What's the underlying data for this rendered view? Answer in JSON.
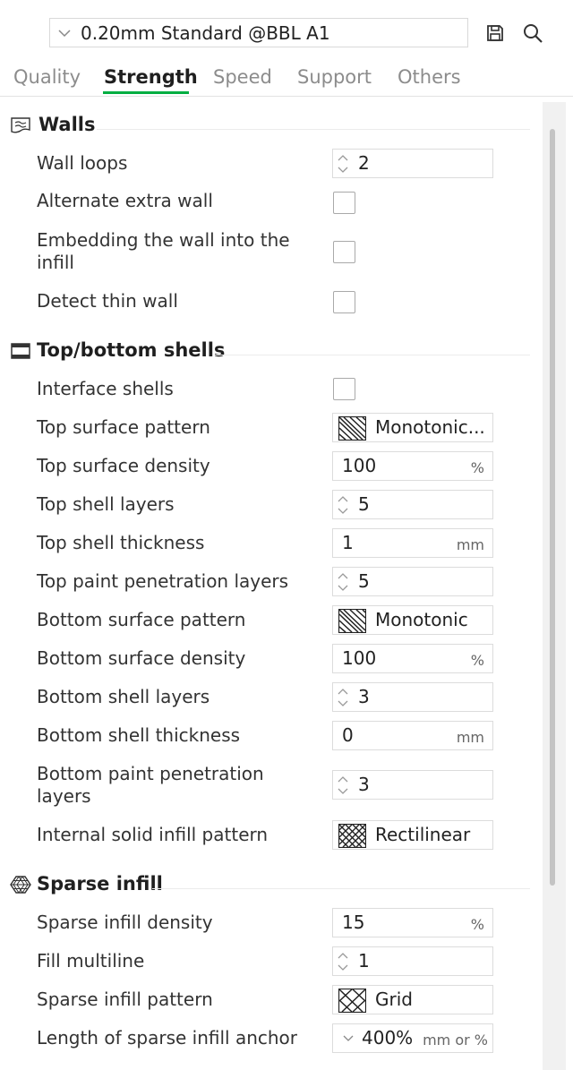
{
  "preset": {
    "value": "0.20mm Standard @BBL A1",
    "save_icon": "save-icon",
    "search_icon": "search-icon"
  },
  "tabs": [
    {
      "label": "Quality",
      "active": false
    },
    {
      "label": "Strength",
      "active": true
    },
    {
      "label": "Speed",
      "active": false
    },
    {
      "label": "Support",
      "active": false
    },
    {
      "label": "Others",
      "active": false
    }
  ],
  "colors": {
    "accent": "#00ae42"
  },
  "walls": {
    "title": "Walls",
    "icon": "walls-icon",
    "wall_loops": {
      "label": "Wall loops",
      "value": "2"
    },
    "alternate_extra_wall": {
      "label": "Alternate extra wall",
      "checked": false
    },
    "embedding_wall": {
      "label": "Embedding the wall into the infill",
      "checked": false
    },
    "detect_thin_wall": {
      "label": "Detect thin wall",
      "checked": false
    }
  },
  "shells": {
    "title": "Top/bottom shells",
    "icon": "shells-icon",
    "interface_shells": {
      "label": "Interface shells",
      "checked": false
    },
    "top_surface_pattern": {
      "label": "Top surface pattern",
      "value": "Monotonic..."
    },
    "top_surface_density": {
      "label": "Top surface density",
      "value": "100",
      "unit": "%"
    },
    "top_shell_layers": {
      "label": "Top shell layers",
      "value": "5"
    },
    "top_shell_thickness": {
      "label": "Top shell thickness",
      "value": "1",
      "unit": "mm"
    },
    "top_paint_layers": {
      "label": "Top paint penetration layers",
      "value": "5"
    },
    "bottom_surface_pattern": {
      "label": "Bottom surface pattern",
      "value": "Monotonic"
    },
    "bottom_surface_density": {
      "label": "Bottom surface density",
      "value": "100",
      "unit": "%"
    },
    "bottom_shell_layers": {
      "label": "Bottom shell layers",
      "value": "3"
    },
    "bottom_shell_thickness": {
      "label": "Bottom shell thickness",
      "value": "0",
      "unit": "mm"
    },
    "bottom_paint_layers": {
      "label": "Bottom paint penetration layers",
      "value": "3"
    },
    "internal_solid_pattern": {
      "label": "Internal solid infill pattern",
      "value": "Rectilinear"
    }
  },
  "infill": {
    "title": "Sparse infill",
    "icon": "sparse-infill-icon",
    "density": {
      "label": "Sparse infill density",
      "value": "15",
      "unit": "%"
    },
    "fill_multiline": {
      "label": "Fill multiline",
      "value": "1"
    },
    "pattern": {
      "label": "Sparse infill pattern",
      "value": "Grid"
    },
    "anchor": {
      "label": "Length of sparse infill anchor",
      "value": "400%",
      "unit": "mm or %"
    }
  }
}
